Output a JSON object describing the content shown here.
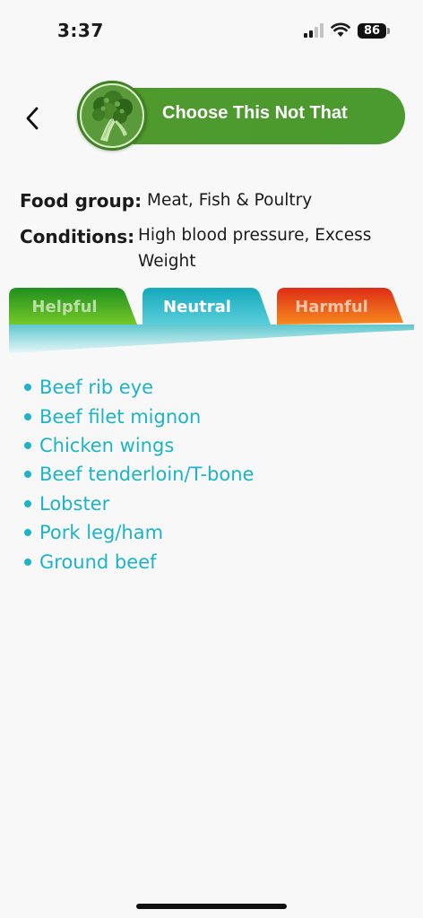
{
  "status_bar": {
    "time": "3:37",
    "battery_level": "86"
  },
  "header": {
    "title": "Choose This Not That",
    "logo_icon": "broccoli-icon",
    "back_icon": "chevron-left-icon"
  },
  "info": {
    "food_group_label": "Food group:",
    "food_group_value": "Meat, Fish & Poultry",
    "conditions_label": "Conditions:",
    "conditions_line1": "High blood pressure, Excess",
    "conditions_line2": "Weight"
  },
  "tabs": [
    {
      "label": "Helpful",
      "selected": false,
      "color": "#3aa12a"
    },
    {
      "label": "Neutral",
      "selected": true,
      "color": "#1bb3c6"
    },
    {
      "label": "Harmful",
      "selected": false,
      "color": "#e8401c"
    }
  ],
  "foods": [
    "Beef rib eye",
    "Beef filet mignon",
    "Chicken wings",
    "Beef tenderloin/T-bone",
    "Lobster",
    "Pork leg/ham",
    "Ground beef"
  ],
  "colors": {
    "brand_green": "#4a9a2f",
    "list_text": "#1cb4c8",
    "background": "#f8f8f8"
  }
}
